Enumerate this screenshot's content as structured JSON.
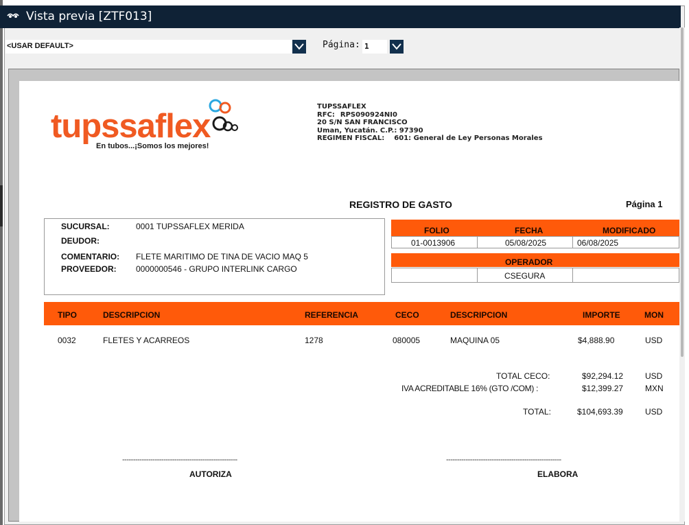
{
  "window": {
    "title": "Vista previa [ZTF013]"
  },
  "toolbar": {
    "template_value": "<USAR DEFAULT>",
    "page_label": "Página:",
    "page_value": "1"
  },
  "company": {
    "logo_text": "tupssaflex",
    "tagline": "En tubos...¡Somos los mejores!",
    "name": "TUPSSAFLEX",
    "rfc_label": "RFC:",
    "rfc": "RPS090924NI0",
    "address1": "20 S/N SAN FRANCISCO",
    "address2": "Uman, Yucatán. C.P.: 97390",
    "regimen_label": "REGIMEN FISCAL:",
    "regimen": "601: General de Ley Personas Morales"
  },
  "document": {
    "title": "REGISTRO DE GASTO",
    "page": "Página 1"
  },
  "info": {
    "sucursal_label": "SUCURSAL:",
    "sucursal": "0001  TUPSSAFLEX MERIDA",
    "deudor_label": "DEUDOR:",
    "comentario_label": "COMENTARIO:",
    "comentario": "FLETE MARITIMO DE TINA DE VACIO MAQ 5",
    "proveedor_label": "PROVEEDOR:",
    "proveedor": "0000000546 - GRUPO INTERLINK CARGO"
  },
  "folio": {
    "folio_label": "FOLIO",
    "fecha_label": "FECHA",
    "modificado_label": "MODIFICADO",
    "folio": "01-0013906",
    "fecha": "05/08/2025",
    "modificado": "06/08/2025",
    "operador_label": "OPERADOR",
    "operador": "CSEGURA"
  },
  "table": {
    "headers": [
      "TIPO",
      "DESCRIPCION",
      "REFERENCIA",
      "CECO",
      "DESCRIPCION",
      "IMPORTE",
      "MON"
    ],
    "rows": [
      [
        "0032",
        "FLETES Y ACARREOS",
        "1278",
        "080005",
        "MAQUINA 05",
        "$4,888.90",
        "USD"
      ]
    ]
  },
  "totals": {
    "ceco_label": "TOTAL CECO:",
    "ceco_value": "$92,294.12",
    "ceco_cur": "USD",
    "iva_label": "IVA ACREDITABLE 16% (GTO /COM) :",
    "iva_value": "$12,399.27",
    "iva_cur": "MXN",
    "total_label": "TOTAL:",
    "total_value": "$104,693.39",
    "total_cur": "USD"
  },
  "signatures": {
    "line": "-----------------------------------------------------",
    "autoriza": "AUTORIZA",
    "elabora": "ELABORA"
  }
}
